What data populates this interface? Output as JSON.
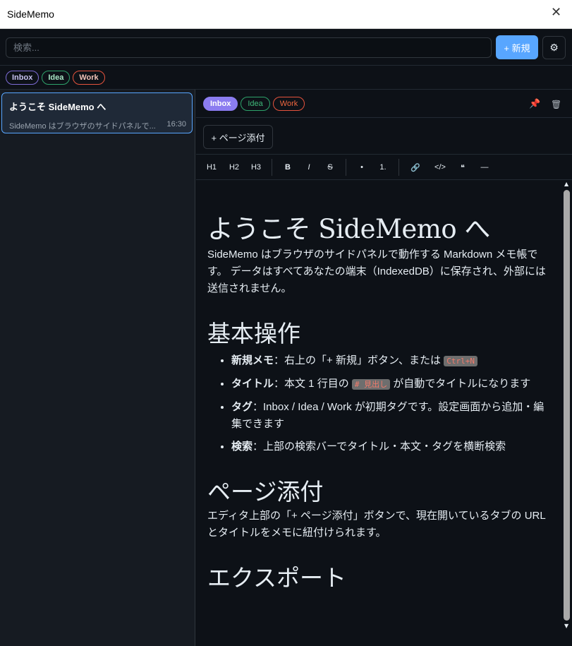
{
  "window": {
    "title": "SideMemo",
    "close_glyph": "✕"
  },
  "toolbar": {
    "search_placeholder": "検索...",
    "new_label": "+ 新規",
    "settings_glyph": "⚙"
  },
  "filter_tags": [
    "Inbox",
    "Idea",
    "Work"
  ],
  "memo_list": [
    {
      "title": "ようこそ SideMemo へ",
      "preview": "SideMemo はブラウザのサイドパネルで...",
      "time": "16:30"
    }
  ],
  "editor": {
    "tags": [
      "Inbox",
      "Idea",
      "Work"
    ],
    "pin_glyph": "📌",
    "trash_glyph": "🗑",
    "attach_label": "+ ページ添付",
    "format_buttons": [
      "H1",
      "H2",
      "H3",
      "B",
      "I",
      "S",
      "•",
      "1.",
      "🔗",
      "</>",
      "❝",
      "—"
    ],
    "doc": {
      "h1": "ようこそ SideMemo へ",
      "intro": "SideMemo はブラウザのサイドパネルで動作する Markdown メモ帳です。 データはすべてあなたの端末（IndexedDB）に保存され、外部には送信されません。",
      "h2_basic": "基本操作",
      "li1_bold": "新規メモ",
      "li1_text": "：右上の「+ 新規」ボタン、または ",
      "li1_code": "Ctrl+N",
      "li2_bold": "タイトル",
      "li2_text": "：本文 1 行目の ",
      "li2_code": "# 見出し",
      "li2_text2": " が自動でタイトルになります",
      "li3_bold": "タグ",
      "li3_text": "：Inbox / Idea / Work が初期タグです。設定画面から追加・編集できます",
      "li4_bold": "検索",
      "li4_text": "：上部の検索バーでタイトル・本文・タグを横断検索",
      "h2_attach": "ページ添付",
      "attach_text": "エディタ上部の「+ ページ添付」ボタンで、現在開いているタブの URL とタイトルをメモに紐付けられます。",
      "h2_export": "エクスポート"
    }
  },
  "scrollbar": {
    "up": "▲",
    "down": "▼"
  }
}
